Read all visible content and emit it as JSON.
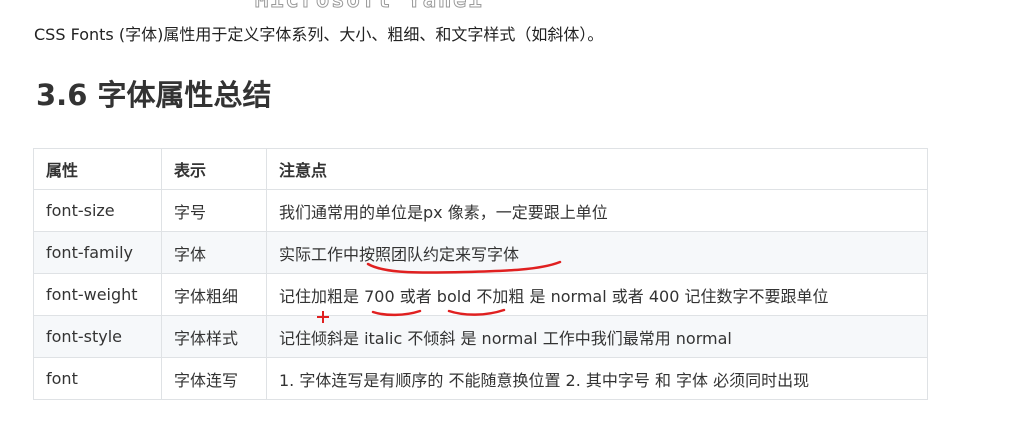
{
  "top_text": "Microsoft Yahei",
  "intro": "CSS Fonts (字体)属性用于定义字体系列、大小、粗细、和文字样式（如斜体）。",
  "heading": "3.6 字体属性总结",
  "table": {
    "headers": [
      "属性",
      "表示",
      "注意点"
    ],
    "rows": [
      {
        "prop": "font-size",
        "meaning": "字号",
        "note": "我们通常用的单位是px 像素，一定要跟上单位"
      },
      {
        "prop": "font-family",
        "meaning": "字体",
        "note": "实际工作中按照团队约定来写字体"
      },
      {
        "prop": "font-weight",
        "meaning": "字体粗细",
        "note": "记住加粗是 700 或者 bold  不加粗 是 normal 或者  400  记住数字不要跟单位"
      },
      {
        "prop": "font-style",
        "meaning": "字体样式",
        "note": "记住倾斜是 italic     不倾斜 是 normal  工作中我们最常用 normal"
      },
      {
        "prop": "font",
        "meaning": "字体连写",
        "note": "1. 字体连写是有顺序的  不能随意换位置 2. 其中字号 和 字体 必须同时出现"
      }
    ]
  },
  "annotation_color": "#e02020"
}
